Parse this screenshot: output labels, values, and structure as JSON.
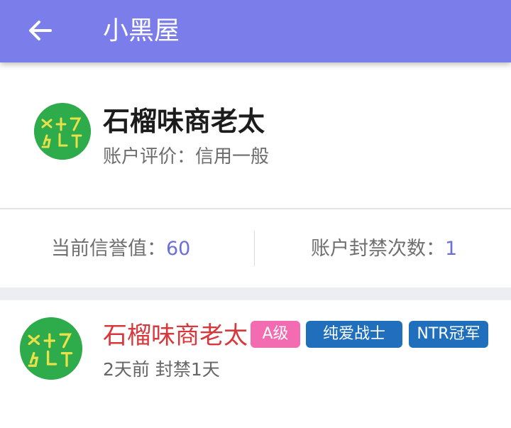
{
  "topbar": {
    "back_icon": "arrow-left-icon",
    "title": "小黑屋"
  },
  "profile": {
    "avatar_icon": "doodle-avatar",
    "name": "石榴味商老太",
    "rating": "账户评价：信用一般"
  },
  "stats": {
    "credit_label": "当前信誉值：",
    "credit_value": "60",
    "ban_label": "账户封禁次数：",
    "ban_value": "1"
  },
  "post": {
    "name": "石榴味商老太",
    "badges": {
      "level": "A级",
      "tag1": "纯爱战士",
      "tag2": "NTR冠军"
    },
    "meta": "2天前 封禁1天"
  },
  "colors": {
    "topbar": "#7b7eea",
    "accent_number": "#6a70d8",
    "post_name": "#d8383b",
    "badge_level": "#f36bb0",
    "badge_tag": "#1f6fbd",
    "avatar_bg": "#2eab4a"
  }
}
